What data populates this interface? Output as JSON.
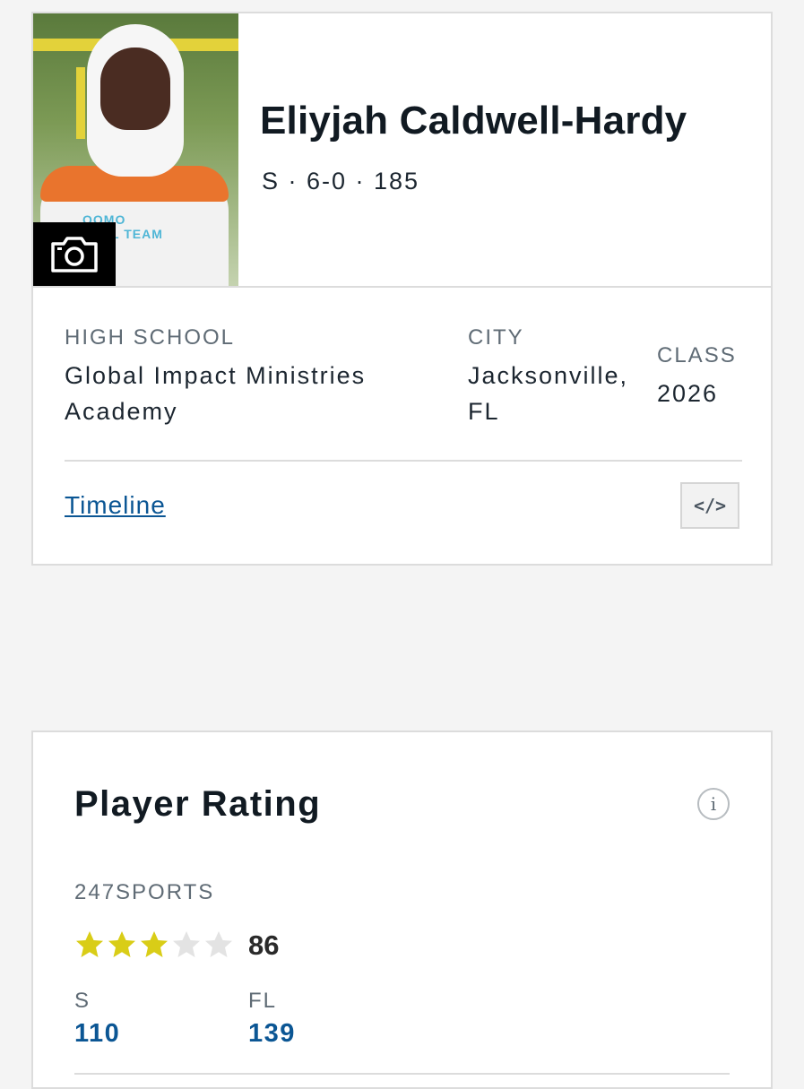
{
  "player": {
    "name": "Eliyjah Caldwell-Hardy",
    "meta": "S · 6-0 · 185",
    "photo_jersey_text": "OOMO\nNAL TEAM"
  },
  "info": {
    "high_school_label": "HIGH SCHOOL",
    "high_school_value": "Global Impact Ministries Academy",
    "city_label": "CITY",
    "city_value": "Jacksonville, FL",
    "class_label": "CLASS",
    "class_value": "2026"
  },
  "links": {
    "timeline": "Timeline",
    "embed_icon": "code-embed-icon"
  },
  "rating": {
    "title": "Player Rating",
    "info_icon_label": "i",
    "source": "247SPORTS",
    "stars_filled": 3,
    "stars_total": 5,
    "score": "86",
    "position_label": "S",
    "position_rank": "110",
    "state_label": "FL",
    "state_rank": "139"
  },
  "colors": {
    "star_filled": "#d9cd17",
    "star_empty": "#e3e3e3",
    "link": "#0b5694"
  }
}
